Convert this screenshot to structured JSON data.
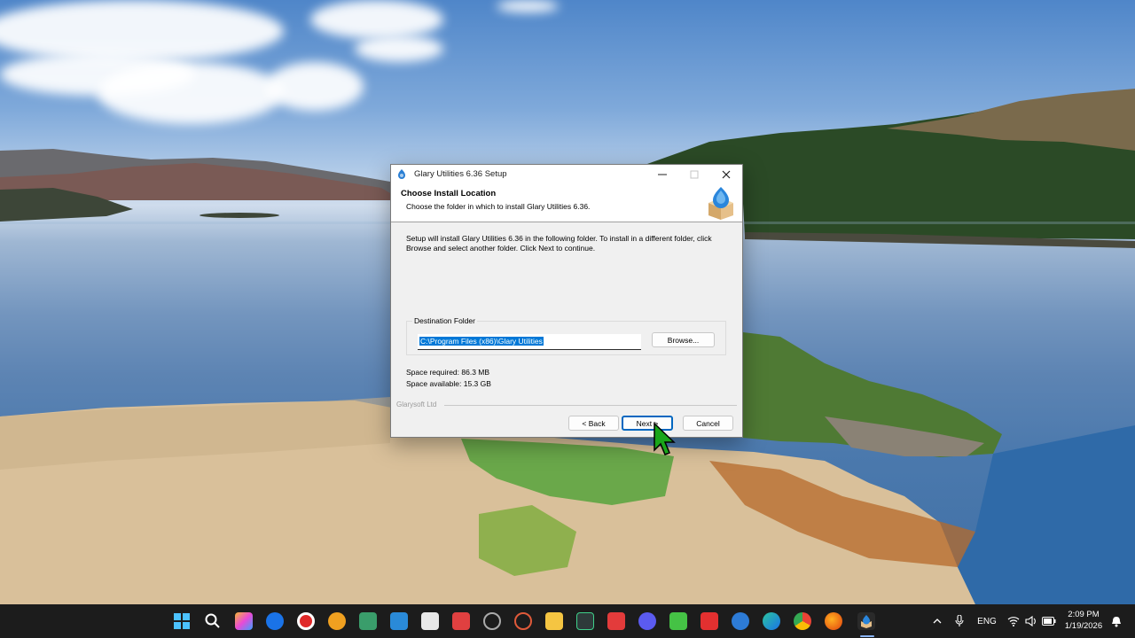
{
  "dialog": {
    "title": "Glary Utilities 6.36 Setup",
    "header_title": "Choose Install Location",
    "header_subtitle": "Choose the folder in which to install Glary Utilities 6.36.",
    "intro_text": "Setup will install Glary Utilities 6.36 in the following folder. To install in a different folder, click Browse and select another folder. Click Next to continue.",
    "destination_label": "Destination Folder",
    "destination_value": "C:\\Program Files (x86)\\Glary Utilities",
    "browse_label": "Browse...",
    "space_required": "Space required: 86.3 MB",
    "space_available": "Space available: 15.3 GB",
    "brand": "Glarysoft Ltd",
    "back_label": "< Back",
    "next_label": "Next >",
    "cancel_label": "Cancel"
  },
  "taskbar": {
    "apps": [
      "start",
      "search",
      "copilot",
      "zoom",
      "media",
      "app",
      "files",
      "photos",
      "snip",
      "app",
      "app",
      "app",
      "file-explorer",
      "terminal",
      "power",
      "app",
      "app",
      "app",
      "app",
      "edge",
      "chrome",
      "firefox",
      "setup"
    ],
    "language": "ENG",
    "time": "2:09 PM",
    "date": "1/19/2026"
  },
  "colors": {
    "accent": "#0078d7",
    "taskbar": "#1c1c1c",
    "dialog_bg": "#f0f0f0"
  }
}
